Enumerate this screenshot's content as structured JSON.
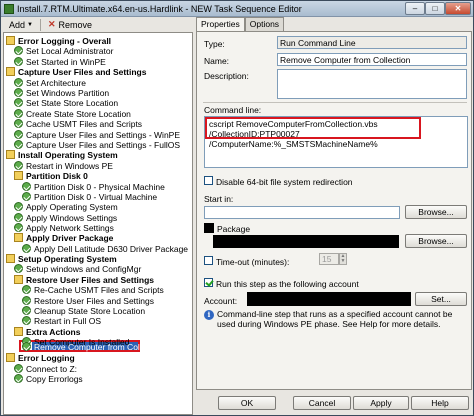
{
  "window": {
    "title": "Install.7.RTM.Ultimate.x64.en-us.Hardlink - NEW Task Sequence Editor",
    "close_glyph": "✕",
    "min_glyph": "–",
    "max_glyph": "□"
  },
  "toolbar": {
    "add_label": "Add",
    "remove_label": "Remove"
  },
  "tree": [
    {
      "label": "Error Logging - Overall",
      "kind": "group",
      "bold": true
    },
    {
      "label": "Set Local Administrator",
      "kind": "step"
    },
    {
      "label": "Set Started in WinPE",
      "kind": "step"
    },
    {
      "label": "Capture User Files and Settings",
      "kind": "group",
      "bold": true
    },
    {
      "label": "Set Architecture",
      "kind": "step"
    },
    {
      "label": "Set Windows Partition",
      "kind": "step"
    },
    {
      "label": "Set State Store Location",
      "kind": "step"
    },
    {
      "label": "Create State Store Location",
      "kind": "step"
    },
    {
      "label": "Cache USMT Files and Scripts",
      "kind": "step"
    },
    {
      "label": "Capture User Files and Settings - WinPE",
      "kind": "step"
    },
    {
      "label": "Capture User Files and Settings - FullOS",
      "kind": "step"
    },
    {
      "label": "Install Operating System",
      "kind": "group",
      "bold": true
    },
    {
      "label": "Restart in Windows PE",
      "kind": "step"
    },
    {
      "label": "Partition Disk 0",
      "kind": "group",
      "bold": true
    },
    {
      "label": "Partition Disk 0 - Physical Machine",
      "kind": "step"
    },
    {
      "label": "Partition Disk 0 - Virtual Machine",
      "kind": "step"
    },
    {
      "label": "Apply Operating System",
      "kind": "step"
    },
    {
      "label": "Apply Windows Settings",
      "kind": "step"
    },
    {
      "label": "Apply Network Settings",
      "kind": "step"
    },
    {
      "label": "Apply Driver Package",
      "kind": "group",
      "bold": true
    },
    {
      "label": "Apply Dell Latitude D630 Driver Package",
      "kind": "step"
    },
    {
      "label": "Setup Operating System",
      "kind": "group",
      "bold": true
    },
    {
      "label": "Setup windows and ConfigMgr",
      "kind": "step"
    },
    {
      "label": "Restore User Files and Settings",
      "kind": "group",
      "bold": true
    },
    {
      "label": "Re-Cache USMT Files and Scripts",
      "kind": "step"
    },
    {
      "label": "Restore User Files and Settings",
      "kind": "step"
    },
    {
      "label": "Cleanup State Store Location",
      "kind": "step"
    },
    {
      "label": "Restart in Full OS",
      "kind": "step"
    },
    {
      "label": "Extra Actions",
      "kind": "group",
      "bold": true
    },
    {
      "label": "Set Computer Is Installed",
      "kind": "step"
    },
    {
      "label": "Remove Computer from Collection",
      "kind": "step",
      "selected": true
    },
    {
      "label": "Error Logging",
      "kind": "group",
      "bold": true
    },
    {
      "label": "Connect to Z:",
      "kind": "step"
    },
    {
      "label": "Copy Errorlogs",
      "kind": "step"
    }
  ],
  "tabs": {
    "properties": "Properties",
    "options": "Options"
  },
  "properties": {
    "type_label": "Type:",
    "type_value": "Run Command Line",
    "name_label": "Name:",
    "name_value": "Remove Computer from Collection",
    "description_label": "Description:",
    "description_value": "",
    "command_line_label": "Command line:",
    "command_line_value": "cscript RemoveComputerFromCollection.vbs /CollectionID:PTP00027 /ComputerName:%_SMSTSMachineName%",
    "disable64_label": "Disable 64-bit file system redirection",
    "start_in_label": "Start in:",
    "start_in_value": "",
    "browse_label": "Browse...",
    "package_label": "Package",
    "browse2_label": "Browse...",
    "timeout_label": "Time-out (minutes):",
    "timeout_value": "15",
    "run_as_label": "Run this step as the following account",
    "account_label": "Account:",
    "set_label": "Set...",
    "info_text": "Command-line step that runs as a specified account cannot be used during Windows PE phase. See Help for more details.",
    "info_glyph": "i"
  },
  "buttons": {
    "ok": "OK",
    "cancel": "Cancel",
    "apply": "Apply",
    "help": "Help"
  }
}
